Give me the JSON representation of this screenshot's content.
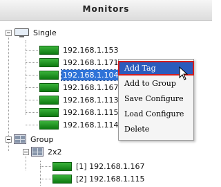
{
  "header": {
    "title": "Monitors"
  },
  "tree": {
    "single": {
      "label": "Single",
      "items": [
        {
          "label": "192.168.1.153",
          "selected": false
        },
        {
          "label": "192.168.1.171",
          "selected": false
        },
        {
          "label": "192.168.1.104",
          "selected": true
        },
        {
          "label": "192.168.1.167",
          "selected": false
        },
        {
          "label": "192.168.1.113",
          "selected": false
        },
        {
          "label": "192.168.1.115",
          "selected": false
        },
        {
          "label": "192.168.1.114",
          "selected": false
        }
      ]
    },
    "group": {
      "label": "Group",
      "subgroup": {
        "label": "2x2",
        "items": [
          {
            "label": "[1] 192.168.1.167"
          },
          {
            "label": "[2] 192.168.1.115"
          }
        ]
      }
    }
  },
  "context_menu": {
    "items": [
      {
        "label": "Add Tag",
        "highlighted": true
      },
      {
        "label": "Add to Group",
        "highlighted": false
      },
      {
        "label": "Save Configure",
        "highlighted": false
      },
      {
        "label": "Load Configure",
        "highlighted": false
      },
      {
        "label": "Delete",
        "highlighted": false
      }
    ]
  },
  "colors": {
    "selection": "#2f73d8",
    "menu_highlight": "#2b5bbd",
    "highlight_border": "#d41c1c",
    "camera_green": "#1f9a22"
  },
  "icons": {
    "single": "monitor-icon",
    "group": "group-grid-icon",
    "device": "camera-icon",
    "cursor": "mouse-pointer-icon"
  }
}
